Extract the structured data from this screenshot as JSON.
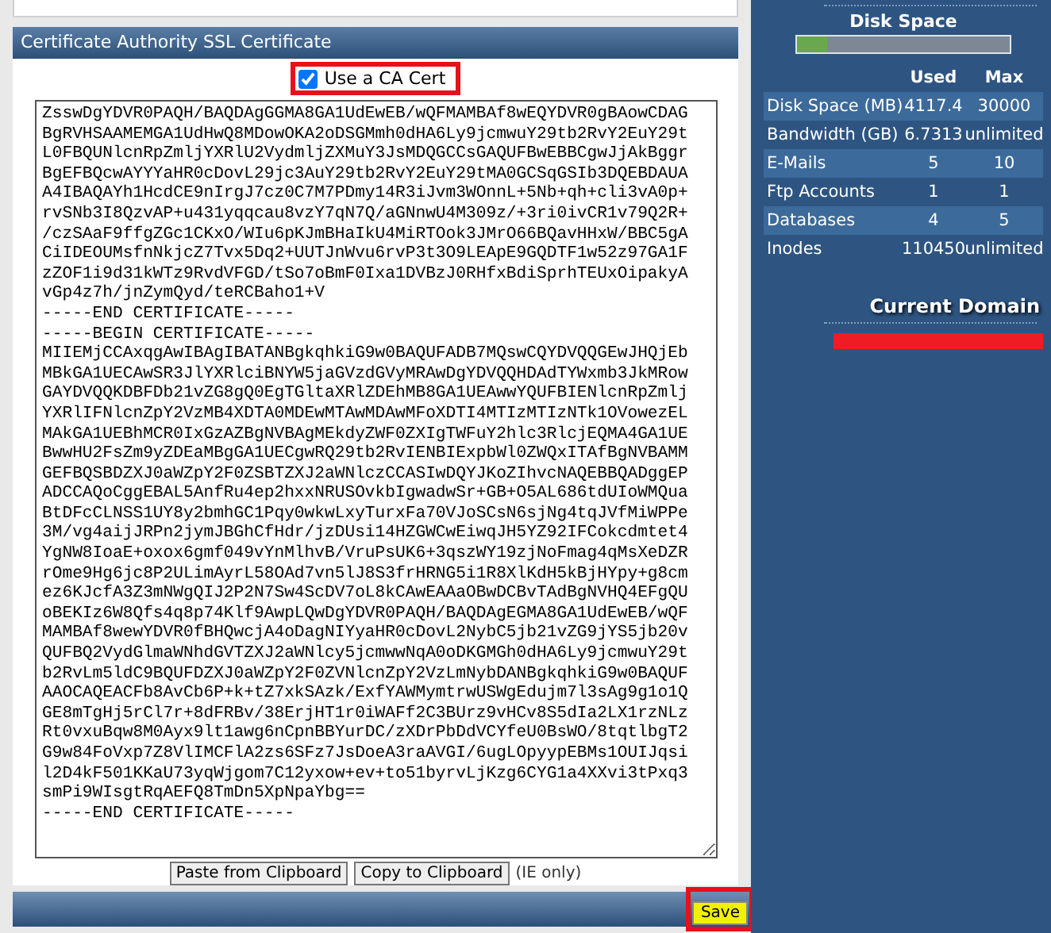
{
  "ssl_panel": {
    "title": "Certificate Authority SSL Certificate",
    "use_ca_cert": {
      "label": "Use a CA Cert",
      "checked": true
    },
    "certificate_text": "ZsswDgYDVR0PAQH/BAQDAgGGMA8GA1UdEwEB/wQFMAMBAf8wEQYDVR0gBAowCDAG\nBgRVHSAAMEMGA1UdHwQ8MDowOKA2oDSGMmh0dHA6Ly9jcmwuY29tb2RvY2EuY29t\nL0FBQUNlcnRpZmljYXRlU2VydmljZXMuY3JsMDQGCCsGAQUFBwEBBCgwJjAkBggr\nBgEFBQcwAYYYaHR0cDovL29jc3AuY29tb2RvY2EuY29tMA0GCSqGSIb3DQEBDAUA\nA4IBAQAYh1HcdCE9nIrgJ7cz0C7M7PDmy14R3iJvm3WOnnL+5Nb+qh+cli3vA0p+\nrvSNb3I8QzvAP+u431yqqcau8vzY7qN7Q/aGNnwU4M309z/+3ri0ivCR1v79Q2R+\n/czSAaF9ffgZGc1CKxO/WIu6pKJmBHaIkU4MiRTOok3JMrO66BQavHHxW/BBC5gA\nCiIDEOUMsfnNkjcZ7Tvx5Dq2+UUTJnWvu6rvP3t3O9LEApE9GQDTF1w52z97GA1F\nzZOF1i9d31kWTz9RvdVFGD/tSo7oBmF0Ixa1DVBzJ0RHfxBdiSprhTEUxOipakyA\nvGp4z7h/jnZymQyd/teRCBaho1+V\n-----END CERTIFICATE-----\n-----BEGIN CERTIFICATE-----\nMIIEMjCCAxqgAwIBAgIBATANBgkqhkiG9w0BAQUFADB7MQswCQYDVQQGEwJHQjEb\nMBkGA1UECAwSR3JlYXRlciBNYW5jaGVzdGVyMRAwDgYDVQQHDAdTYWxmb3JkMRow\nGAYDVQQKDBFDb21vZG8gQ0EgTGltaXRlZDEhMB8GA1UEAwwYQUFBIENlcnRpZmlj\nYXRlIFNlcnZpY2VzMB4XDTA0MDEwMTAwMDAwMFoXDTI4MTIzMTIzNTk1OVowezEL\nMAkGA1UEBhMCR0IxGzAZBgNVBAgMEkdyZWF0ZXIgTWFuY2hlc3RlcjEQMA4GA1UE\nBwwHU2FsZm9yZDEaMBgGA1UECgwRQ29tb2RvIENBIExpbWl0ZWQxITAfBgNVBAMM\nGEFBQSBDZXJ0aWZpY2F0ZSBTZXJ2aWNlczCCASIwDQYJKoZIhvcNAQEBBQADggEP\nADCCAQoCggEBAL5AnfRu4ep2hxxNRUSOvkbIgwadwSr+GB+O5AL686tdUIoWMQua\nBtDFcCLNSS1UY8y2bmhGC1Pqy0wkwLxyTurxFa70VJoSCsN6sjNg4tqJVfMiWPPe\n3M/vg4aijJRPn2jymJBGhCfHdr/jzDUsi14HZGWCwEiwqJH5YZ92IFCokcdmtet4\nYgNW8IoaE+oxox6gmf049vYnMlhvB/VruPsUK6+3qszWY19zjNoFmag4qMsXeDZR\nrOme9Hg6jc8P2ULimAyrL58OAd7vn5lJ8S3frHRNG5i1R8XlKdH5kBjHYpy+g8cm\nez6KJcfA3Z3mNWgQIJ2P2N7Sw4ScDV7oL8kCAwEAAaOBwDCBvTAdBgNVHQ4EFgQU\noBEKIz6W8Qfs4q8p74Klf9AwpLQwDgYDVR0PAQH/BAQDAgEGMA8GA1UdEwEB/wQF\nMAMBAf8wewYDVR0fBHQwcjA4oDagNIYyaHR0cDovL2NybC5jb21vZG9jYS5jb20v\nQUFBQ2VydGlmaWNhdGVTZXJ2aWNlcy5jcmwwNqA0oDKGMGh0dHA6Ly9jcmwuY29t\nb2RvLm5ldC9BQUFDZXJ0aWZpY2F0ZVNlcnZpY2VzLmNybDANBgkqhkiG9w0BAQUF\nAAOCAQEACFb8AvCb6P+k+tZ7xkSAzk/ExfYAWMymtrwUSWgEdujm7l3sAg9g1o1Q\nGE8mTgHj5rCl7r+8dFRBv/38ErjHT1r0iWAFf2C3BUrz9vHCv8S5dIa2LX1rzNLz\nRt0vxuBqw8M0Ayx9lt1awg6nCpnBBYurDC/zXDrPbDdVCYfeU0BsWO/8tqtlbgT2\nG9w84FoVxp7Z8VlIMCFlA2zs6SFz7JsDoeA3raAVGI/6ugLOpyypEBMs1OUIJqsi\nl2D4kF501KKaU73yqWjgom7C12yxow+ev+to51byrvLjKzg6CYG1a4XXvi3tPxq3\nsmPi9WIsgtRqAEFQ8TmDn5XpNpaYbg==\n-----END CERTIFICATE-----",
    "buttons": [
      "Paste from Clipboard",
      "Copy to Clipboard"
    ],
    "note": "(IE only)",
    "save_button": "Save"
  },
  "sidebar": {
    "disk_space": {
      "title": "Disk Space",
      "level": 0.14
    },
    "columns": [
      "Used",
      "Max"
    ],
    "rows": [
      {
        "name": "Disk Space (MB)",
        "used": "4117.4",
        "max": "30000"
      },
      {
        "name": "Bandwidth (GB)",
        "used": "6.7313",
        "max": "unlimited"
      },
      {
        "name": "E-Mails",
        "used": "5",
        "max": "10"
      },
      {
        "name": "Ftp Accounts",
        "used": "1",
        "max": "1"
      },
      {
        "name": "Databases",
        "used": "4",
        "max": "5"
      },
      {
        "name": "Inodes",
        "used": "110450",
        "max": "unlimited"
      }
    ],
    "current_domain": {
      "title": "Current Domain"
    }
  }
}
